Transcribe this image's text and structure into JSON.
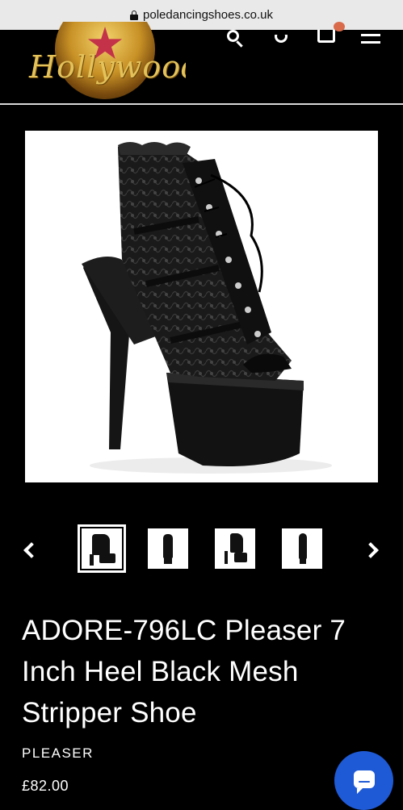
{
  "browser": {
    "url": "poledancingshoes.co.uk"
  },
  "header": {
    "logo_text": "Hollywood",
    "icons": [
      "search-icon",
      "account-icon",
      "cart-icon",
      "menu-icon"
    ]
  },
  "product": {
    "title": "ADORE-796LC Pleaser 7 Inch Heel Black Mesh Stripper Shoe",
    "vendor": "PLEASER",
    "price": "£82.00",
    "thumbnails": 4,
    "active_thumbnail": 1
  },
  "colors": {
    "page_bg": "#000000",
    "chat_button": "#1f5ad6",
    "text": "#ffffff"
  }
}
